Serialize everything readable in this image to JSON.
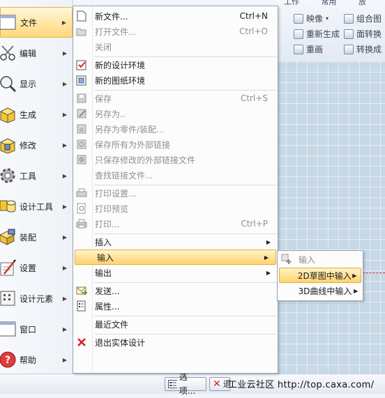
{
  "background": {
    "ribbon_tabs": [
      "工作",
      "常用",
      "放"
    ],
    "ribbon_buttons": [
      {
        "label": "映像",
        "icon": "mirror-icon"
      },
      {
        "label": "组合图",
        "icon": "combine-icon"
      },
      {
        "label": "重新生成",
        "icon": "regenerate-icon"
      },
      {
        "label": "面转换",
        "icon": "face-convert-icon"
      },
      {
        "label": "重画",
        "icon": "redraw-icon"
      },
      {
        "label": "转换成",
        "icon": "convert-icon"
      }
    ],
    "status_options_label": "选项...",
    "status_exit_label": "退",
    "watermark": "工业云社区 http://top.caxa.com/"
  },
  "leftbar": {
    "items": [
      {
        "label": "文件",
        "icon": "file-icon",
        "selected": true
      },
      {
        "label": "编辑",
        "icon": "scissors-icon"
      },
      {
        "label": "显示",
        "icon": "magnifier-icon"
      },
      {
        "label": "生成",
        "icon": "generate-icon"
      },
      {
        "label": "修改",
        "icon": "modify-icon"
      },
      {
        "label": "工具",
        "icon": "gear-icon"
      },
      {
        "label": "设计工具",
        "icon": "design-tools-icon"
      },
      {
        "label": "装配",
        "icon": "assembly-icon"
      },
      {
        "label": "设置",
        "icon": "settings-icon"
      },
      {
        "label": "设计元素",
        "icon": "design-elements-icon"
      },
      {
        "label": "窗口",
        "icon": "window-icon"
      },
      {
        "label": "帮助",
        "icon": "help-icon"
      }
    ]
  },
  "menu": {
    "items": [
      {
        "label": "新文件...",
        "shortcut": "Ctrl+N",
        "icon": "new-file-icon",
        "enabled": true
      },
      {
        "label": "打开文件...",
        "shortcut": "Ctrl+O",
        "icon": "open-folder-icon",
        "enabled": false
      },
      {
        "label": "关闭",
        "shortcut": "",
        "icon": "",
        "enabled": false
      },
      {
        "label": "新的设计环境",
        "shortcut": "",
        "icon": "new-design-env-icon",
        "enabled": true
      },
      {
        "label": "新的图纸环境",
        "shortcut": "",
        "icon": "new-drawing-env-icon",
        "enabled": true
      },
      {
        "label": "保存",
        "shortcut": "Ctrl+S",
        "icon": "save-icon",
        "enabled": false
      },
      {
        "label": "另存为..",
        "shortcut": "",
        "icon": "save-as-icon",
        "enabled": false
      },
      {
        "label": "另存为零件/装配...",
        "shortcut": "",
        "icon": "save-as-part-icon",
        "enabled": false
      },
      {
        "label": "保存所有为外部链接",
        "shortcut": "",
        "icon": "save-all-links-icon",
        "enabled": false
      },
      {
        "label": "只保存修改的外部链接文件",
        "shortcut": "",
        "icon": "save-modified-links-icon",
        "enabled": false
      },
      {
        "label": "查找链接文件...",
        "shortcut": "",
        "icon": "",
        "enabled": false
      },
      {
        "label": "打印设置...",
        "shortcut": "",
        "icon": "print-setup-icon",
        "enabled": false
      },
      {
        "label": "打印预览",
        "shortcut": "",
        "icon": "print-preview-icon",
        "enabled": false
      },
      {
        "label": "打印...",
        "shortcut": "Ctrl+P",
        "icon": "print-icon",
        "enabled": false
      },
      {
        "label": "插入",
        "shortcut": "",
        "icon": "",
        "enabled": true,
        "submenu": true
      },
      {
        "label": "输入",
        "shortcut": "",
        "icon": "",
        "enabled": true,
        "submenu": true,
        "highlighted": true
      },
      {
        "label": "输出",
        "shortcut": "",
        "icon": "",
        "enabled": true,
        "submenu": true
      },
      {
        "label": "发送...",
        "shortcut": "",
        "icon": "send-mail-icon",
        "enabled": true
      },
      {
        "label": "属性...",
        "shortcut": "",
        "icon": "properties-icon",
        "enabled": true
      },
      {
        "label": "最近文件",
        "shortcut": "",
        "icon": "",
        "enabled": true
      },
      {
        "label": "退出实体设计",
        "shortcut": "",
        "icon": "exit-x-icon",
        "enabled": true
      }
    ]
  },
  "submenu": {
    "items": [
      {
        "label": "输入",
        "icon": "import-icon",
        "enabled": false
      },
      {
        "label": "2D草图中输入",
        "enabled": true,
        "submenu": true,
        "highlighted": true
      },
      {
        "label": "3D曲线中输入",
        "enabled": true,
        "submenu": true
      }
    ]
  },
  "colors": {
    "highlight_top": "#fff3c8",
    "highlight_bottom": "#ffd36e",
    "exit_red": "#d62020"
  }
}
